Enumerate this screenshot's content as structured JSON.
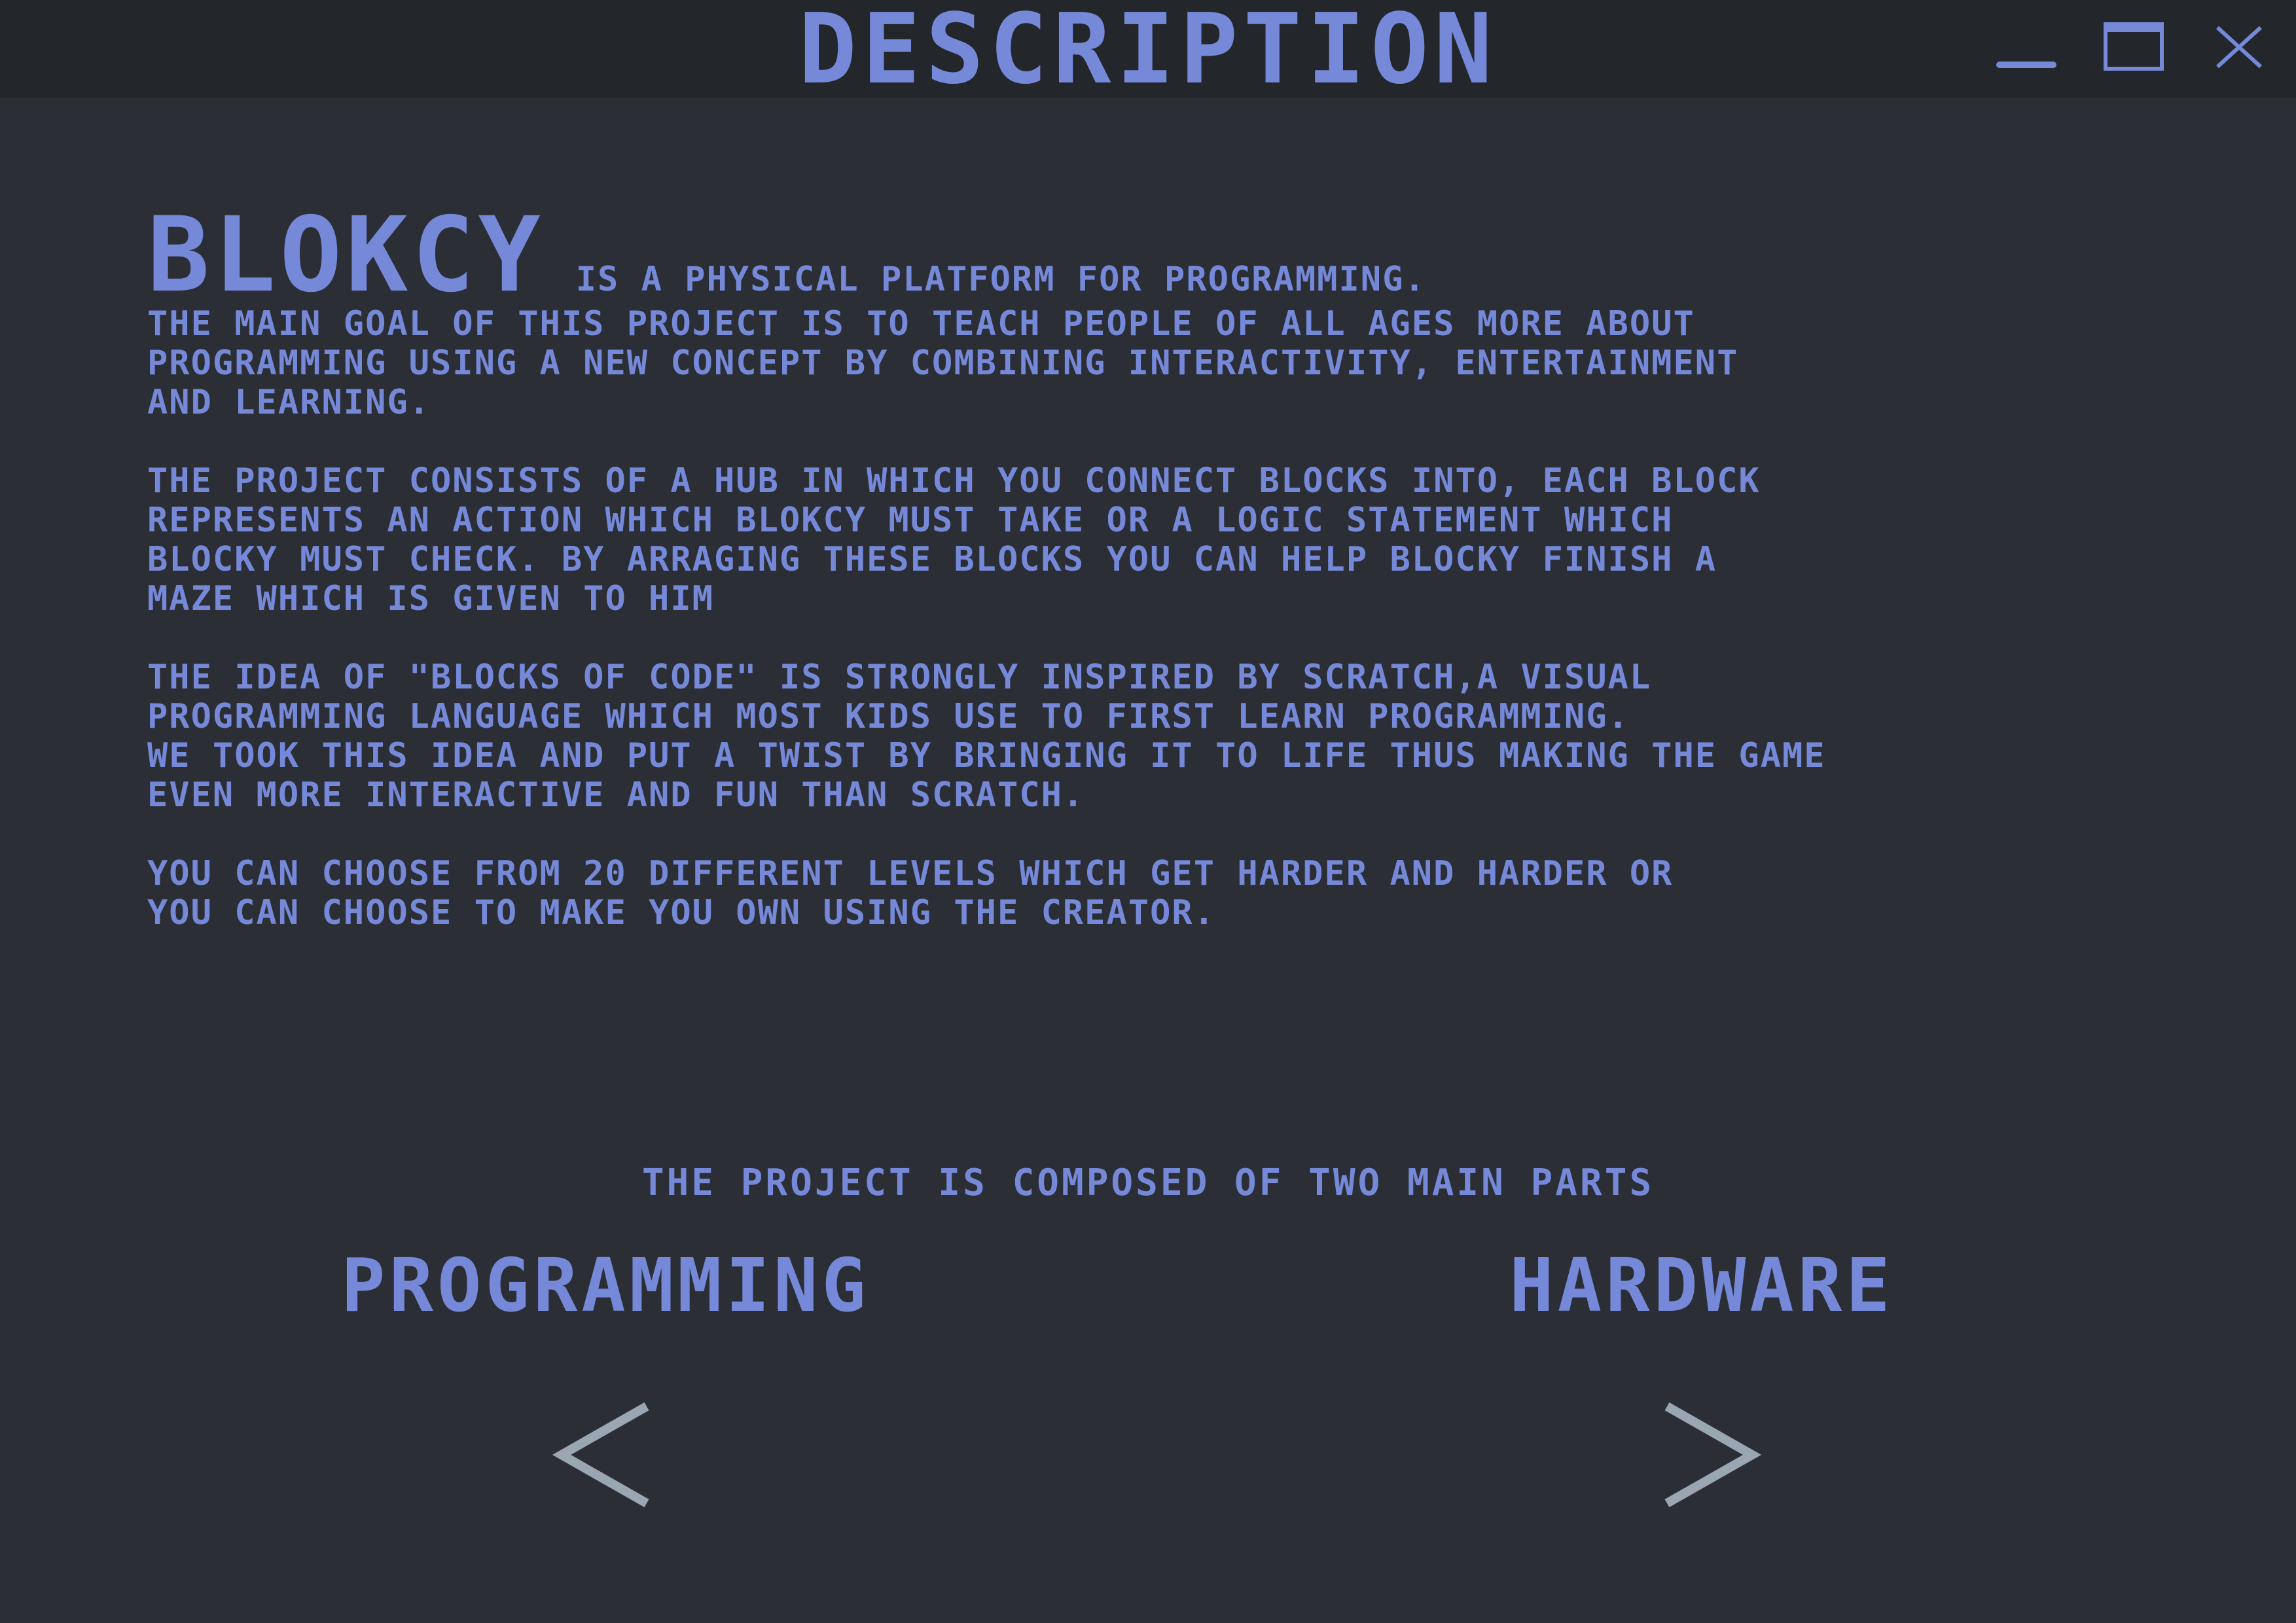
{
  "window": {
    "title": "DESCRIPTION",
    "controls": {
      "minimize_icon": "minimize-icon",
      "maximize_icon": "maximize-icon",
      "close_icon": "close-icon"
    }
  },
  "intro": {
    "brand": "BLOKCY",
    "tagline": "IS A PHYSICAL PLATFORM FOR PROGRAMMING.",
    "paragraphs": [
      [
        "THE MAIN GOAL OF THIS PROJECT IS TO TEACH PEOPLE OF ALL AGES MORE ABOUT",
        "PROGRAMMING USING A NEW CONCEPT BY COMBINING INTERACTIVITY, ENTERTAINMENT",
        "AND LEARNING."
      ],
      [
        "THE PROJECT CONSISTS OF A HUB IN WHICH YOU CONNECT BLOCKS INTO, EACH BLOCK",
        "REPRESENTS AN ACTION WHICH BLOKCY MUST TAKE OR A LOGIC STATEMENT WHICH",
        "BLOCKY MUST CHECK. BY ARRAGING THESE BLOCKS YOU CAN HELP BLOCKY FINISH A",
        "MAZE WHICH IS GIVEN TO HIM"
      ],
      [
        "THE IDEA OF \"BLOCKS OF CODE\" IS STRONGLY INSPIRED BY SCRATCH,A VISUAL",
        "PROGRAMMING LANGUAGE WHICH MOST KIDS USE TO FIRST LEARN PROGRAMMING.",
        "WE TOOK THIS IDEA AND PUT A TWIST BY BRINGING IT TO LIFE THUS MAKING THE GAME",
        "EVEN MORE INTERACTIVE AND FUN THAN SCRATCH."
      ],
      [
        "YOU CAN CHOOSE FROM 20 DIFFERENT LEVELS WHICH GET HARDER AND HARDER OR",
        "YOU CAN CHOOSE TO MAKE YOU OWN USING THE CREATOR."
      ]
    ]
  },
  "parts": {
    "heading": "THE PROJECT IS COMPOSED OF TWO MAIN PARTS",
    "left": "PROGRAMMING",
    "right": "HARDWARE"
  },
  "nav": {
    "prev_icon": "chevron-left-icon",
    "next_icon": "chevron-right-icon"
  },
  "colors": {
    "background": "#2b2e35",
    "titlebar": "#23262b",
    "accent_text": "#7589d8",
    "arrow": "#9aa7b3"
  }
}
